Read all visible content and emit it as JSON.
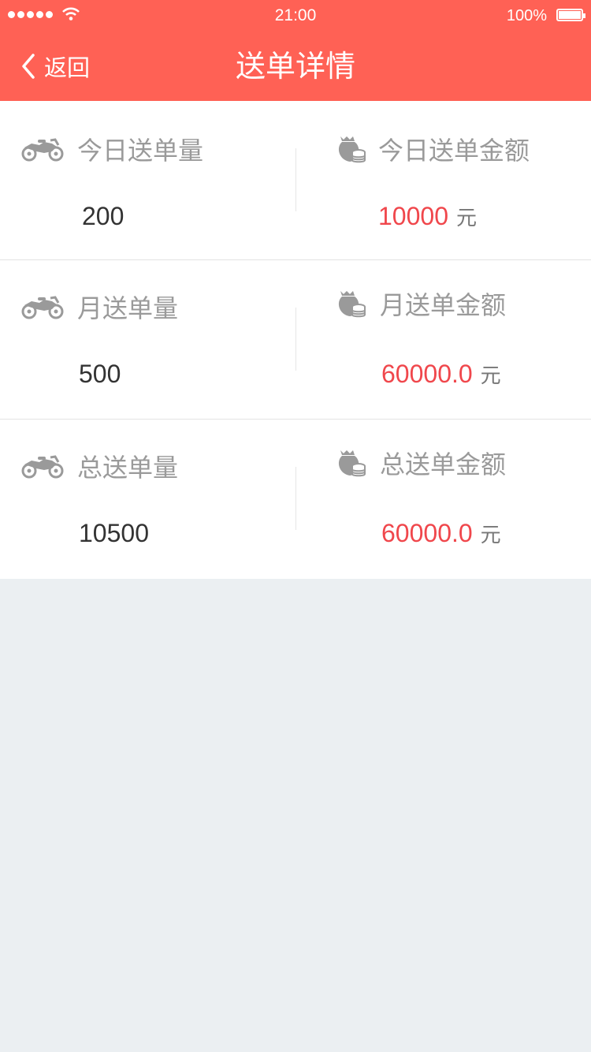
{
  "status_bar": {
    "time": "21:00",
    "battery": "100%"
  },
  "nav": {
    "back_label": "返回",
    "title": "送单详情"
  },
  "colors": {
    "brand": "#ff6155",
    "amount": "#f0474c",
    "label": "#9a9a9a",
    "background": "#ebeff2"
  },
  "stats": [
    {
      "count_label": "今日送单量",
      "count_value": "200",
      "amount_label": "今日送单金额",
      "amount_value": "10000",
      "unit": "元",
      "count_icon": "motorcycle-icon",
      "amount_icon": "money-bag-icon"
    },
    {
      "count_label": "月送单量",
      "count_value": "500",
      "amount_label": "月送单金额",
      "amount_value": "60000.0",
      "unit": "元",
      "count_icon": "motorcycle-icon",
      "amount_icon": "money-bag-icon"
    },
    {
      "count_label": "总送单量",
      "count_value": "10500",
      "amount_label": "总送单金额",
      "amount_value": "60000.0",
      "unit": "元",
      "count_icon": "motorcycle-icon",
      "amount_icon": "money-bag-icon"
    }
  ]
}
